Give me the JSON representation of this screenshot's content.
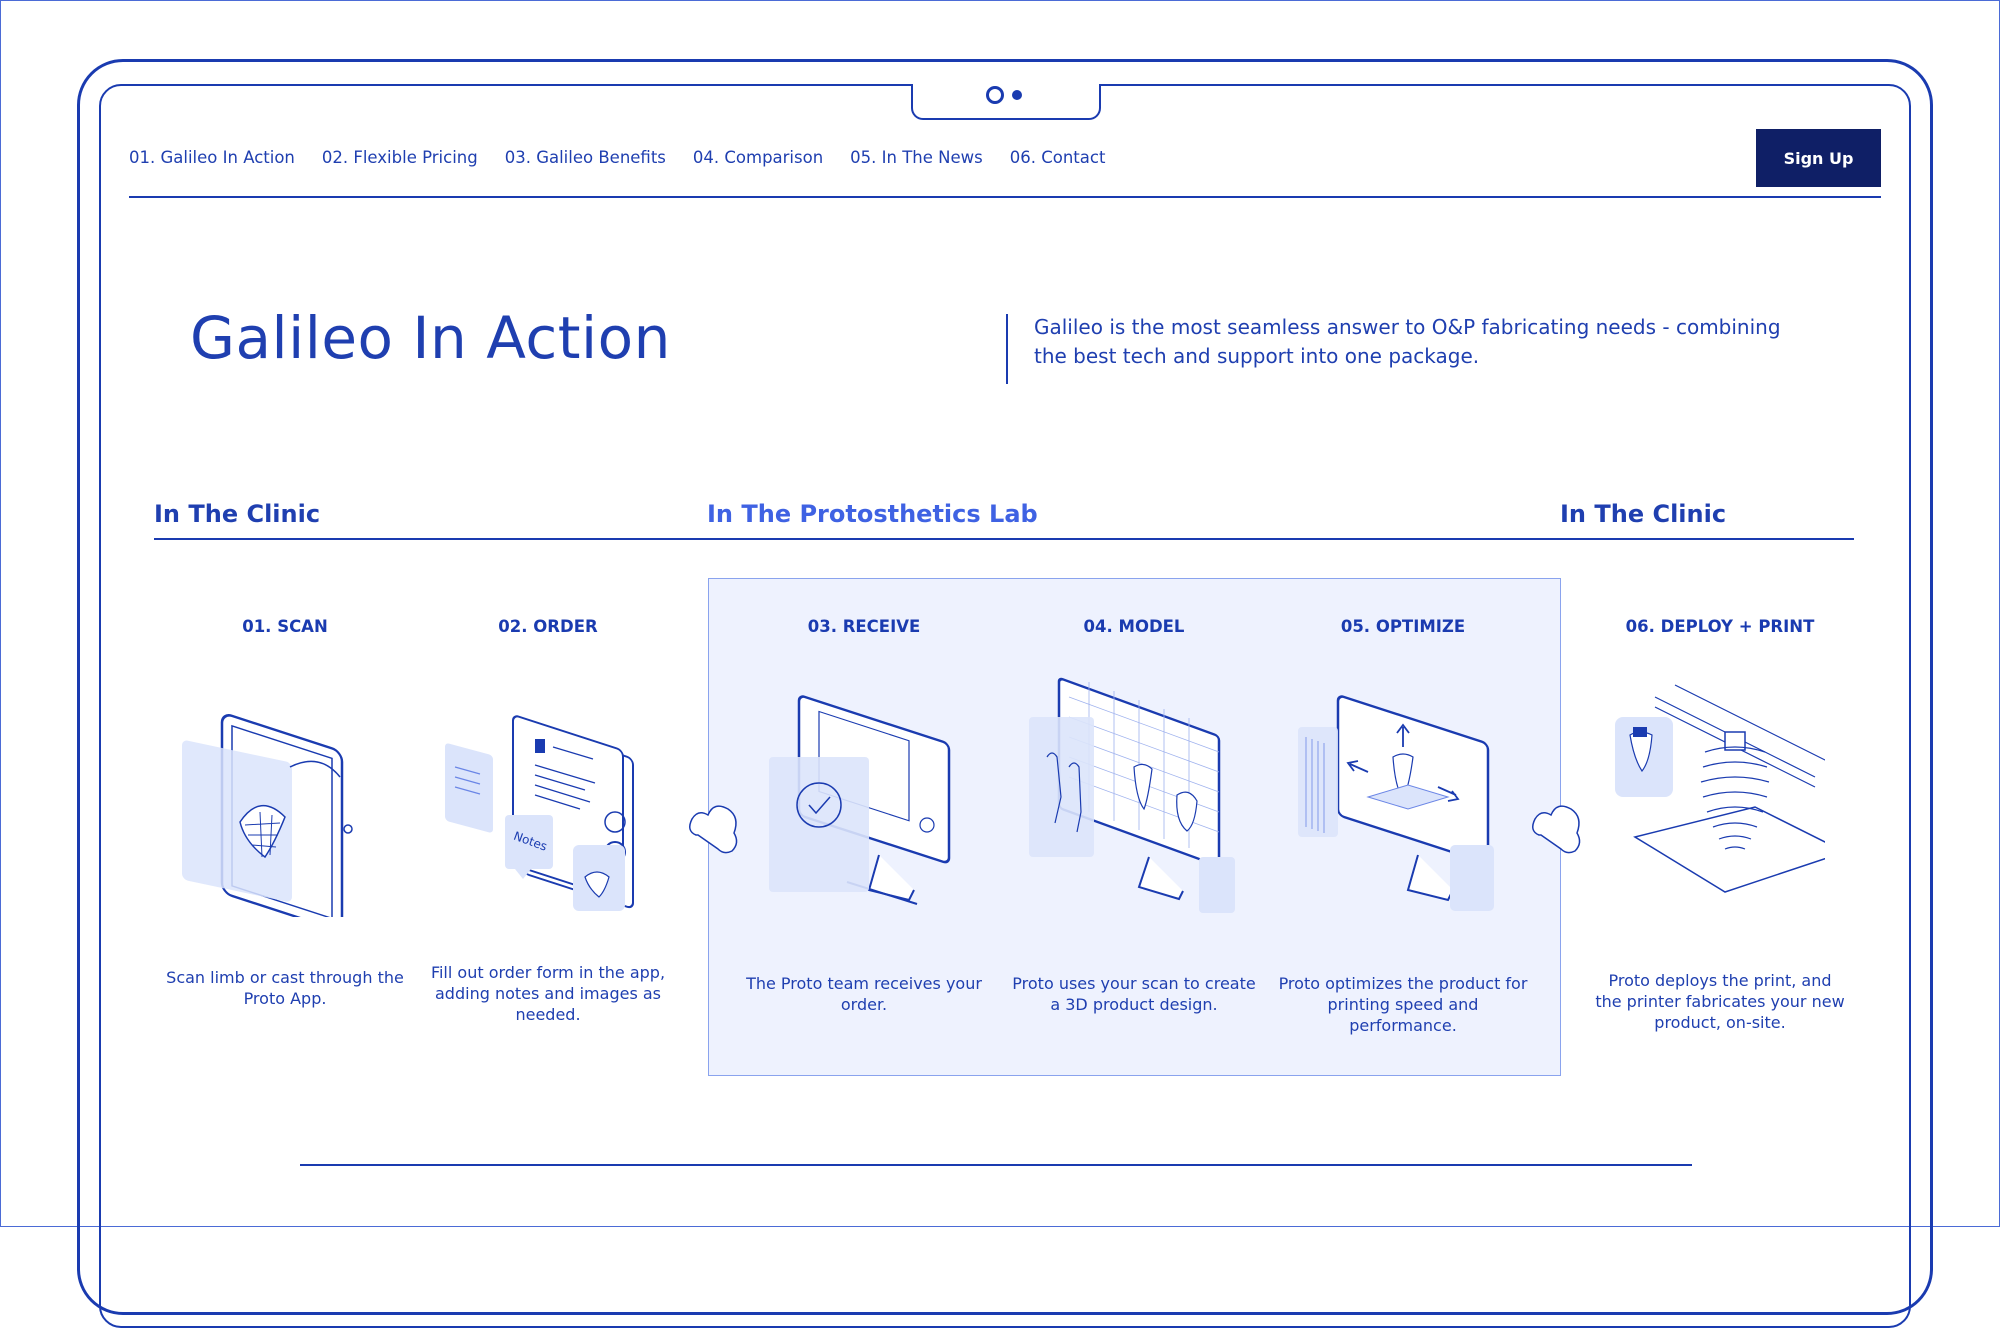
{
  "nav": {
    "items": [
      "01. Galileo In Action",
      "02. Flexible Pricing",
      "03. Galileo Benefits",
      "04. Comparison",
      "05. In The News",
      "06. Contact"
    ],
    "signup_label": "Sign Up"
  },
  "hero": {
    "title": "Galileo In Action",
    "description": "Galileo is the most seamless answer to O&P fabricating needs - combining the best tech and support into one package."
  },
  "sections": {
    "clinic_left": "In The Clinic",
    "lab": "In The Protosthetics Lab",
    "clinic_right": "In The Clinic"
  },
  "steps": [
    {
      "title": "01. SCAN",
      "desc": "Scan limb or cast through the Proto App."
    },
    {
      "title": "02. ORDER",
      "desc": "Fill out order form in the app, adding notes and images as needed.",
      "note_label": "Notes"
    },
    {
      "title": "03. RECEIVE",
      "desc": "The Proto team receives your order."
    },
    {
      "title": "04. MODEL",
      "desc": "Proto uses your scan to create a 3D product design."
    },
    {
      "title": "05. OPTIMIZE",
      "desc": "Proto optimizes the product for printing speed and performance."
    },
    {
      "title": "06. DEPLOY + PRINT",
      "desc": "Proto deploys the print, and the printer fabricates your new product, on-site."
    }
  ],
  "colors": {
    "primary": "#1a3bb0",
    "lab_accent": "#3f62e3",
    "lab_background": "#eef2fe",
    "button_bg": "#0f1f66"
  }
}
